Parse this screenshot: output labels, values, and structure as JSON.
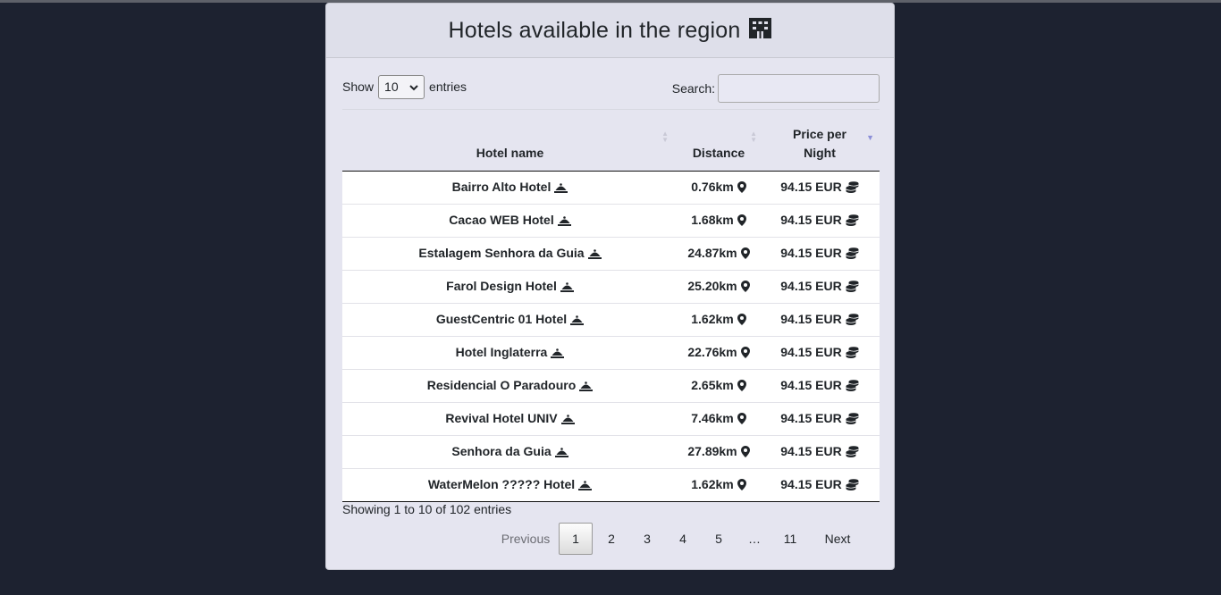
{
  "header": {
    "title": "Hotels available in the region"
  },
  "length": {
    "show_label": "Show",
    "value": "10",
    "entries_label": "entries"
  },
  "search": {
    "label": "Search:",
    "value": ""
  },
  "table": {
    "columns": [
      {
        "label": "Hotel name",
        "sort": "none"
      },
      {
        "label": "Distance",
        "sort": "none"
      },
      {
        "label": "Price per Night",
        "sort": "descending"
      }
    ],
    "rows": [
      {
        "name": "Bairro Alto Hotel",
        "distance": "0.76km",
        "price": "94.15 EUR"
      },
      {
        "name": "Cacao WEB Hotel",
        "distance": "1.68km",
        "price": "94.15 EUR"
      },
      {
        "name": "Estalagem Senhora da Guia",
        "distance": "24.87km",
        "price": "94.15 EUR"
      },
      {
        "name": "Farol Design Hotel",
        "distance": "25.20km",
        "price": "94.15 EUR"
      },
      {
        "name": "GuestCentric 01 Hotel",
        "distance": "1.62km",
        "price": "94.15 EUR"
      },
      {
        "name": "Hotel Inglaterra",
        "distance": "22.76km",
        "price": "94.15 EUR"
      },
      {
        "name": "Residencial O Paradouro",
        "distance": "2.65km",
        "price": "94.15 EUR"
      },
      {
        "name": "Revival Hotel UNIV",
        "distance": "7.46km",
        "price": "94.15 EUR"
      },
      {
        "name": "Senhora da Guia",
        "distance": "27.89km",
        "price": "94.15 EUR"
      },
      {
        "name": "WaterMelon ????? Hotel",
        "distance": "1.62km",
        "price": "94.15 EUR"
      }
    ]
  },
  "info": "Showing 1 to 10 of 102 entries",
  "pagination": {
    "previous": "Previous",
    "pages": [
      "1",
      "2",
      "3",
      "4",
      "5"
    ],
    "ellipsis": "…",
    "last": "11",
    "next": "Next",
    "current": "1"
  },
  "icons": {
    "title": "hotel-icon",
    "name": "concierge-bell-icon",
    "distance": "map-marker-icon",
    "price": "coins-icon"
  },
  "colors": {
    "background": "#1d2230",
    "card": "#e5e5f0",
    "active_sort": "#8c8fd8"
  }
}
